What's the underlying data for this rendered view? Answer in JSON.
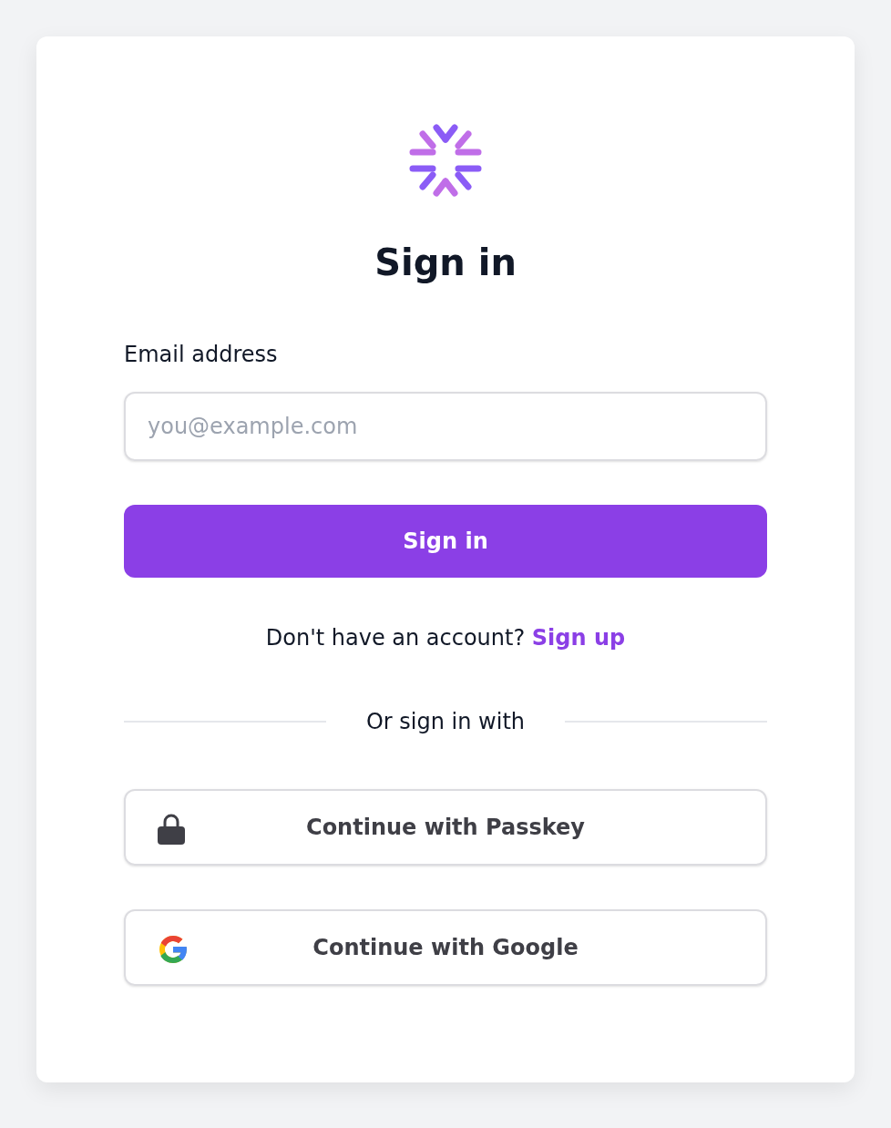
{
  "title": "Sign in",
  "email": {
    "label": "Email address",
    "placeholder": "you@example.com"
  },
  "submit": "Sign in",
  "signup": {
    "text": "Don't have an account?",
    "link": "Sign up"
  },
  "divider": "Or sign in with",
  "providers": [
    {
      "kind": "passkey",
      "label": "Continue with Passkey"
    },
    {
      "kind": "google",
      "label": "Continue with Google"
    }
  ]
}
